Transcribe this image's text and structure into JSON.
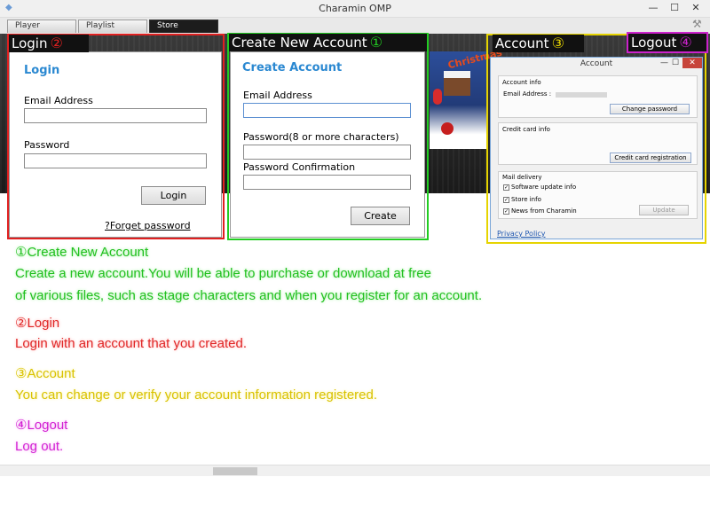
{
  "window": {
    "title": "Charamin OMP",
    "controls": {
      "minimize": "—",
      "maximize": "☐",
      "close": "✕"
    }
  },
  "tabs": [
    {
      "label": "Player"
    },
    {
      "label": "Playlist"
    },
    {
      "label": "Store"
    }
  ],
  "banner_text": "Christmas",
  "highlights": {
    "login": {
      "label": "Login",
      "num": "②",
      "color": "#e02020"
    },
    "create": {
      "label": "Create New Account",
      "num": "①",
      "color": "#22cc22"
    },
    "account": {
      "label": "Account",
      "num": "③",
      "color": "#e6d400"
    },
    "logout": {
      "label": "Logout",
      "num": "④",
      "color": "#cc22cc"
    }
  },
  "login_panel": {
    "title": "Login",
    "email_label": "Email Address",
    "email_value": "",
    "password_label": "Password",
    "password_value": "",
    "login_button": "Login",
    "forgot_link": "?Forget password"
  },
  "create_panel": {
    "title": "Create Account",
    "email_label": "Email Address",
    "email_value": "",
    "password_label": "Password(8 or more characters)",
    "password_value": "",
    "confirm_label": "Password Confirmation",
    "confirm_value": "",
    "create_button": "Create"
  },
  "account_window": {
    "title": "Account",
    "account_info_label": "Account info",
    "email_label": "Email Address :",
    "change_password_button": "Change password",
    "credit_info_label": "Credit card info",
    "credit_register_button": "Credit card registration",
    "mail_delivery_label": "Mail delivery",
    "mail_options": [
      {
        "label": "Software update info",
        "checked": true
      },
      {
        "label": "Store info",
        "checked": true
      },
      {
        "label": "News from Charamin",
        "checked": true
      }
    ],
    "update_button": "Update",
    "privacy_link": "Privacy Policy"
  },
  "descriptions": {
    "create_title": "①Create New Account",
    "create_line1": "Create a new account.You will be able to purchase or download at free",
    "create_line2": "of various files, such as stage characters and when you register for an account.",
    "login_title": "②Login",
    "login_line1": "Login with an account that you created.",
    "account_title": "③Account",
    "account_line1": "You can change or verify your account information registered.",
    "logout_title": "④Logout",
    "logout_line1": "Log out."
  }
}
